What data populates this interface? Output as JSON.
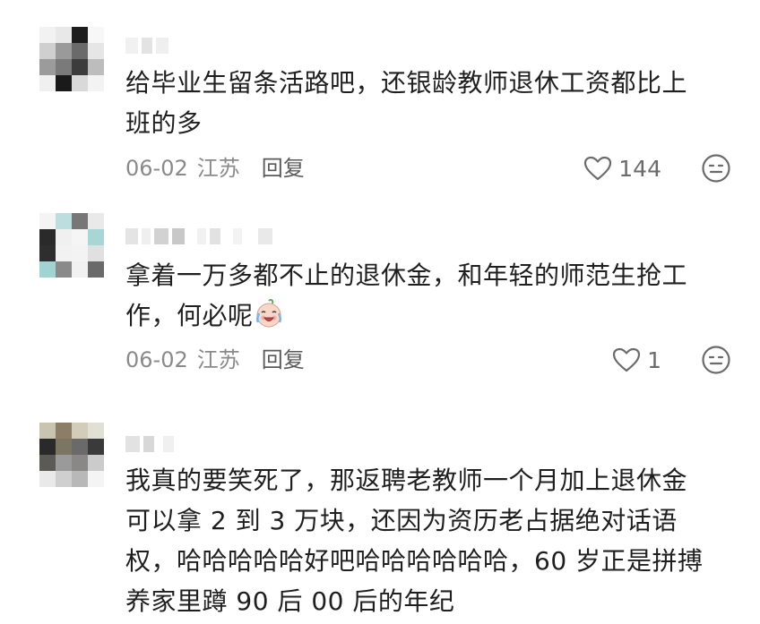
{
  "comments": [
    {
      "text_lines": [
        "给毕业生留条活路吧，还银龄教师退休工资都比上",
        "班的多"
      ],
      "date": "06-02",
      "location": "江苏",
      "reply_label": "回复",
      "likes": "144",
      "avatar_icon": "pixelated-avatar",
      "like_icon": "heart-outline-icon",
      "react_icon": "emoji-face-icon"
    },
    {
      "text_lines": [
        "拿着一万多都不止的退休金，和年轻的师范生抢工",
        "作，何必呢"
      ],
      "inline_emoji": "crying-laughing-emoji",
      "date": "06-02",
      "location": "江苏",
      "reply_label": "回复",
      "likes": "1",
      "avatar_icon": "pixelated-avatar",
      "like_icon": "heart-outline-icon",
      "react_icon": "emoji-face-icon"
    },
    {
      "text_lines": [
        "我真的要笑死了，那返聘老教师一个月加上退休金",
        "可以拿 2 到 3 万块，还因为资历老占据绝对话语",
        "权，哈哈哈哈哈好吧哈哈哈哈哈哈，60 岁正是拼搏",
        "养家里蹲 90 后 00 后的年纪"
      ],
      "avatar_icon": "pixelated-avatar"
    }
  ],
  "colors": {
    "text": "#1f1f1f",
    "meta": "#8a8a8a",
    "icon": "#6b6b6b"
  }
}
